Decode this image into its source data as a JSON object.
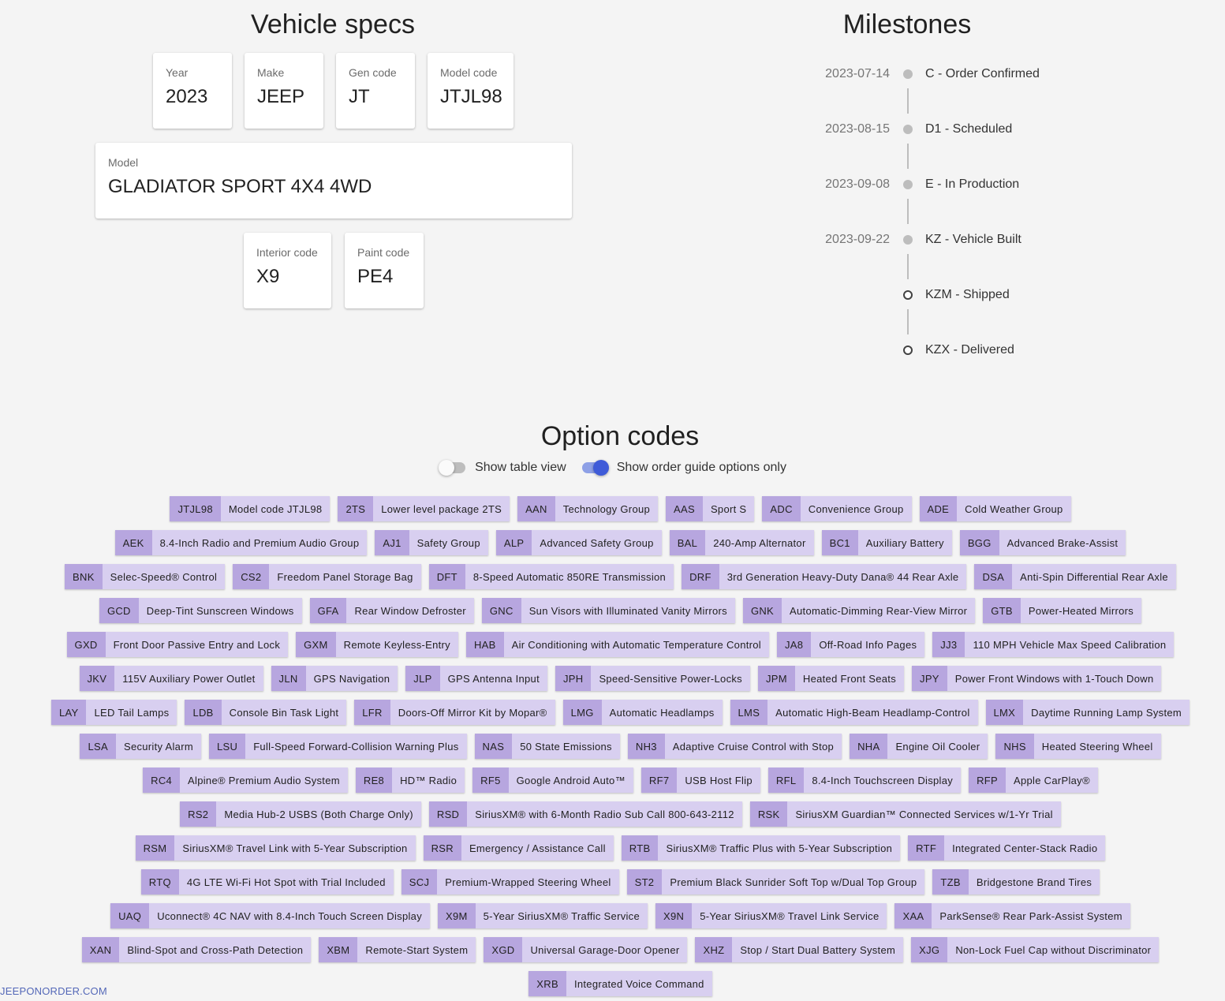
{
  "specs": {
    "title": "Vehicle specs",
    "year": {
      "label": "Year",
      "value": "2023"
    },
    "make": {
      "label": "Make",
      "value": "JEEP"
    },
    "gen_code": {
      "label": "Gen code",
      "value": "JT"
    },
    "model_code": {
      "label": "Model code",
      "value": "JTJL98"
    },
    "model": {
      "label": "Model",
      "value": "GLADIATOR SPORT 4X4 4WD"
    },
    "interior_code": {
      "label": "Interior code",
      "value": "X9"
    },
    "paint_code": {
      "label": "Paint code",
      "value": "PE4"
    }
  },
  "milestones": {
    "title": "Milestones",
    "items": [
      {
        "date": "2023-07-14",
        "label": "C - Order Confirmed",
        "status": "done"
      },
      {
        "date": "2023-08-15",
        "label": "D1 - Scheduled",
        "status": "done"
      },
      {
        "date": "2023-09-08",
        "label": "E - In Production",
        "status": "done"
      },
      {
        "date": "2023-09-22",
        "label": "KZ - Vehicle Built",
        "status": "done"
      },
      {
        "date": "",
        "label": "KZM - Shipped",
        "status": "open"
      },
      {
        "date": "",
        "label": "KZX - Delivered",
        "status": "open"
      }
    ]
  },
  "options": {
    "title": "Option codes",
    "toggle_table": {
      "label": "Show table view",
      "on": false
    },
    "toggle_order_guide": {
      "label": "Show order guide options only",
      "on": true
    },
    "codes": [
      {
        "code": "JTJL98",
        "desc": "Model code JTJL98"
      },
      {
        "code": "2TS",
        "desc": "Lower level package 2TS"
      },
      {
        "code": "AAN",
        "desc": "Technology Group"
      },
      {
        "code": "AAS",
        "desc": "Sport S"
      },
      {
        "code": "ADC",
        "desc": "Convenience Group"
      },
      {
        "code": "ADE",
        "desc": "Cold Weather Group"
      },
      {
        "code": "AEK",
        "desc": "8.4-Inch Radio and Premium Audio Group"
      },
      {
        "code": "AJ1",
        "desc": "Safety Group"
      },
      {
        "code": "ALP",
        "desc": "Advanced Safety Group"
      },
      {
        "code": "BAL",
        "desc": "240-Amp Alternator"
      },
      {
        "code": "BC1",
        "desc": "Auxiliary Battery"
      },
      {
        "code": "BGG",
        "desc": "Advanced Brake-Assist"
      },
      {
        "code": "BNK",
        "desc": "Selec-Speed® Control"
      },
      {
        "code": "CS2",
        "desc": "Freedom Panel Storage Bag"
      },
      {
        "code": "DFT",
        "desc": "8-Speed Automatic 850RE Transmission"
      },
      {
        "code": "DRF",
        "desc": "3rd Generation Heavy-Duty Dana® 44 Rear Axle"
      },
      {
        "code": "DSA",
        "desc": "Anti-Spin Differential Rear Axle"
      },
      {
        "code": "GCD",
        "desc": "Deep-Tint Sunscreen Windows"
      },
      {
        "code": "GFA",
        "desc": "Rear Window Defroster"
      },
      {
        "code": "GNC",
        "desc": "Sun Visors with Illuminated Vanity Mirrors"
      },
      {
        "code": "GNK",
        "desc": "Automatic-Dimming Rear-View Mirror"
      },
      {
        "code": "GTB",
        "desc": "Power-Heated Mirrors"
      },
      {
        "code": "GXD",
        "desc": "Front Door Passive Entry and Lock"
      },
      {
        "code": "GXM",
        "desc": "Remote Keyless-Entry"
      },
      {
        "code": "HAB",
        "desc": "Air Conditioning with Automatic Temperature Control"
      },
      {
        "code": "JA8",
        "desc": "Off-Road Info Pages"
      },
      {
        "code": "JJ3",
        "desc": "110 MPH Vehicle Max Speed Calibration"
      },
      {
        "code": "JKV",
        "desc": "115V Auxiliary Power Outlet"
      },
      {
        "code": "JLN",
        "desc": "GPS Navigation"
      },
      {
        "code": "JLP",
        "desc": "GPS Antenna Input"
      },
      {
        "code": "JPH",
        "desc": "Speed-Sensitive Power-Locks"
      },
      {
        "code": "JPM",
        "desc": "Heated Front Seats"
      },
      {
        "code": "JPY",
        "desc": "Power Front Windows with 1-Touch Down"
      },
      {
        "code": "LAY",
        "desc": "LED Tail Lamps"
      },
      {
        "code": "LDB",
        "desc": "Console Bin Task Light"
      },
      {
        "code": "LFR",
        "desc": "Doors-Off Mirror Kit by Mopar®"
      },
      {
        "code": "LMG",
        "desc": "Automatic Headlamps"
      },
      {
        "code": "LMS",
        "desc": "Automatic High-Beam Headlamp-Control"
      },
      {
        "code": "LMX",
        "desc": "Daytime Running Lamp System"
      },
      {
        "code": "LSA",
        "desc": "Security Alarm"
      },
      {
        "code": "LSU",
        "desc": "Full-Speed Forward-Collision Warning Plus"
      },
      {
        "code": "NAS",
        "desc": "50 State Emissions"
      },
      {
        "code": "NH3",
        "desc": "Adaptive Cruise Control with Stop"
      },
      {
        "code": "NHA",
        "desc": "Engine Oil Cooler"
      },
      {
        "code": "NHS",
        "desc": "Heated Steering Wheel"
      },
      {
        "code": "RC4",
        "desc": "Alpine® Premium Audio System"
      },
      {
        "code": "RE8",
        "desc": "HD™ Radio"
      },
      {
        "code": "RF5",
        "desc": "Google Android Auto™"
      },
      {
        "code": "RF7",
        "desc": "USB Host Flip"
      },
      {
        "code": "RFL",
        "desc": "8.4-Inch Touchscreen Display"
      },
      {
        "code": "RFP",
        "desc": "Apple CarPlay®"
      },
      {
        "code": "RS2",
        "desc": "Media Hub-2 USBS (Both Charge Only)"
      },
      {
        "code": "RSD",
        "desc": "SiriusXM® with 6-Month Radio Sub Call 800-643-2112"
      },
      {
        "code": "RSK",
        "desc": "SiriusXM Guardian™ Connected Services w/1-Yr Trial"
      },
      {
        "code": "RSM",
        "desc": "SiriusXM® Travel Link with 5-Year Subscription"
      },
      {
        "code": "RSR",
        "desc": "Emergency / Assistance Call"
      },
      {
        "code": "RTB",
        "desc": "SiriusXM® Traffic Plus with 5-Year Subscription"
      },
      {
        "code": "RTF",
        "desc": "Integrated Center-Stack Radio"
      },
      {
        "code": "RTQ",
        "desc": "4G LTE Wi-Fi Hot Spot with Trial Included"
      },
      {
        "code": "SCJ",
        "desc": "Premium-Wrapped Steering Wheel"
      },
      {
        "code": "ST2",
        "desc": "Premium Black Sunrider Soft Top w/Dual Top Group"
      },
      {
        "code": "TZB",
        "desc": "Bridgestone Brand Tires"
      },
      {
        "code": "UAQ",
        "desc": "Uconnect® 4C NAV with 8.4-Inch Touch Screen Display"
      },
      {
        "code": "X9M",
        "desc": "5-Year SiriusXM® Traffic Service"
      },
      {
        "code": "X9N",
        "desc": "5-Year SiriusXM® Travel Link Service"
      },
      {
        "code": "XAA",
        "desc": "ParkSense® Rear Park-Assist System"
      },
      {
        "code": "XAN",
        "desc": "Blind-Spot and Cross-Path Detection"
      },
      {
        "code": "XBM",
        "desc": "Remote-Start System"
      },
      {
        "code": "XGD",
        "desc": "Universal Garage-Door Opener"
      },
      {
        "code": "XHZ",
        "desc": "Stop / Start Dual Battery System"
      },
      {
        "code": "XJG",
        "desc": "Non-Lock Fuel Cap without Discriminator"
      },
      {
        "code": "XRB",
        "desc": "Integrated Voice Command"
      }
    ]
  },
  "footer": {
    "brand": "JEEPONORDER.COM"
  }
}
